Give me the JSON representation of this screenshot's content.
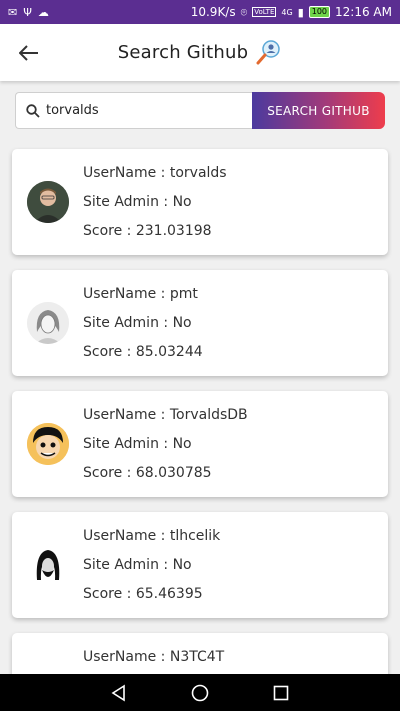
{
  "status_bar": {
    "speed": "10.9K/s",
    "network_label": "VoLTE",
    "signal_label": "4G",
    "battery": "100",
    "time": "12:16 AM"
  },
  "app_bar": {
    "title": "Search Github"
  },
  "search": {
    "value": "torvalds",
    "button_label": "SEARCH GITHUB"
  },
  "labels": {
    "username": "UserName",
    "site_admin": "Site Admin",
    "score": "Score",
    "separator": ":"
  },
  "results": [
    {
      "username": "torvalds",
      "site_admin": "No",
      "score": "231.03198",
      "avatar": "person-photo"
    },
    {
      "username": "pmt",
      "site_admin": "No",
      "score": "85.03244",
      "avatar": "sketch-portrait"
    },
    {
      "username": "TorvaldsDB",
      "site_admin": "No",
      "score": "68.030785",
      "avatar": "cartoon-face"
    },
    {
      "username": "tlhcelik",
      "site_admin": "No",
      "score": "65.46395",
      "avatar": "bearded-figure"
    },
    {
      "username": "N3TC4T",
      "site_admin": "",
      "score": "",
      "avatar": ""
    }
  ],
  "nav": {
    "back": "back-triangle-icon",
    "home": "home-circle-icon",
    "recents": "recents-square-icon"
  },
  "colors": {
    "status_bar": "#5b2e91",
    "button_start": "#4b3a9e",
    "button_end": "#ee3d4c"
  }
}
